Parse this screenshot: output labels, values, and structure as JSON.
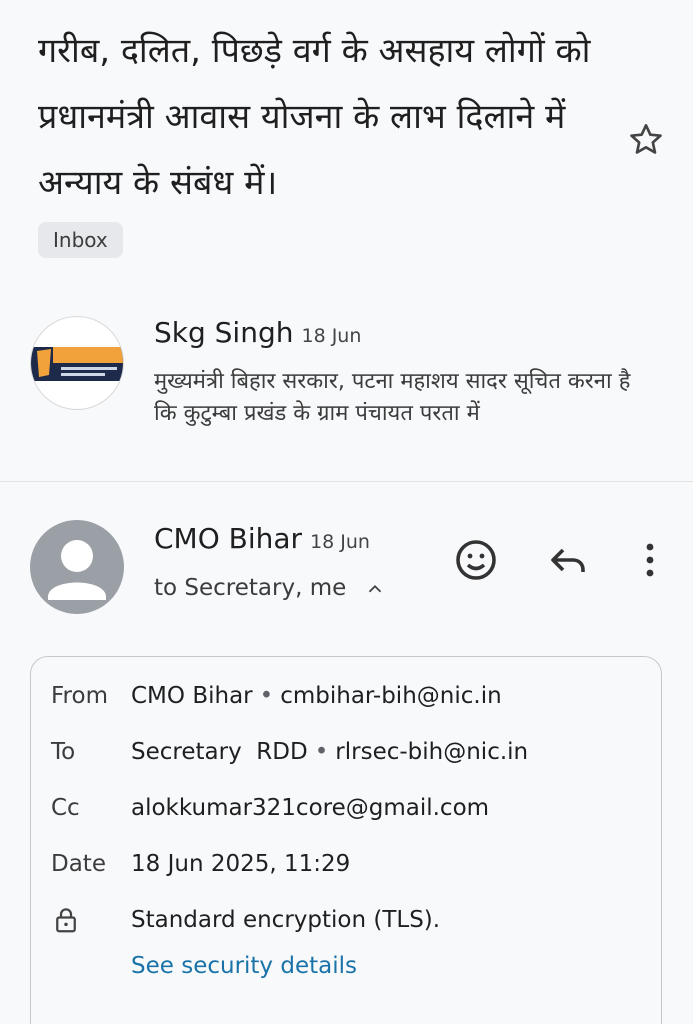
{
  "thread": {
    "subject": "गरीब, दलित, पिछड़े वर्ग के असहाय लोगों को प्रधानमंत्री आवास योजना के लाभ दिलाने में अन्याय के संबंध में।",
    "label": "Inbox"
  },
  "message1": {
    "sender": "Skg Singh",
    "date": "18 Jun",
    "snippet": "मुख्यमंत्री बिहार सरकार, पटना महाशय सादर सूचित करना है कि कुटुम्बा प्रखंड के ग्राम पंचायत परता में"
  },
  "message2": {
    "sender": "CMO Bihar",
    "date": "18 Jun",
    "recipients": "to Secretary, me"
  },
  "details": {
    "from_label": "From",
    "from_name": "CMO Bihar",
    "from_email": "cmbihar-bih@nic.in",
    "to_label": "To",
    "to_name": "Secretary  RDD",
    "to_email": "rlrsec-bih@nic.in",
    "cc_label": "Cc",
    "cc_value": "alokkumar321core@gmail.com",
    "date_label": "Date",
    "date_value": "18 Jun 2025, 11:29",
    "encryption": "Standard encryption (TLS).",
    "security_link": "See security details",
    "separator": "•"
  },
  "icons": [
    "star-icon",
    "smiley-icon",
    "reply-icon",
    "more-vert-icon",
    "chevron-up-icon",
    "lock-icon",
    "person-icon"
  ],
  "colors": {
    "link": "#1a73a8",
    "avatar_gray": "#9aa0a6",
    "background": "#f8f9fb"
  }
}
